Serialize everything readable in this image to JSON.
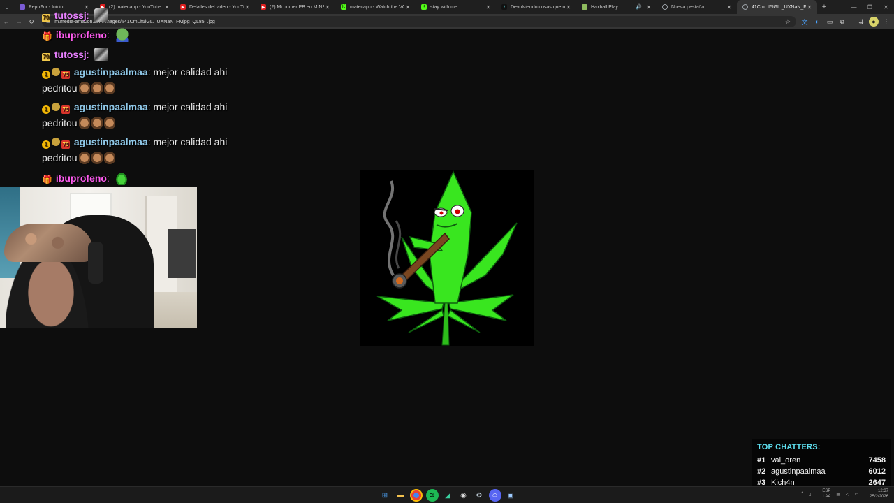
{
  "browser": {
    "tabs": [
      {
        "label": "PepuFor - Inicio",
        "favicon_color": "#7a5bd6"
      },
      {
        "label": "(2) matecapp - YouTube",
        "favicon_color": "#e02020"
      },
      {
        "label": "Detalles del video - YouTube",
        "favicon_color": "#e02020"
      },
      {
        "label": "(2) Mi primer PB en MINECRAFT",
        "favicon_color": "#e02020"
      },
      {
        "label": "matecapp - Watch the VOD of",
        "favicon_color": "#53fc18"
      },
      {
        "label": "stay with me",
        "favicon_color": "#53fc18"
      },
      {
        "label": "Devolviendo cosas que no",
        "favicon_color": "#111111"
      },
      {
        "label": "Haxball Play",
        "favicon_color": "#8fbc5f"
      },
      {
        "label": "Nueva pestaña",
        "favicon_color": "#9aa0a6"
      },
      {
        "label": "41CmLlf5lGL._UXNaN_FMjpg",
        "favicon_color": "#9aa0a6",
        "active": true
      }
    ],
    "url": "m.media-amazon.com/images/I/41CmLlf5lGL._UXNaN_FMjpg_QL85_.jpg",
    "icons": {
      "menu": "chevron-down-icon",
      "back": "back-arrow-icon",
      "forward": "forward-arrow-icon",
      "reload": "reload-icon",
      "star": "star-icon",
      "new_tab": "plus-icon"
    }
  },
  "chat": {
    "messages": [
      {
        "user": "tutossj",
        "text": ""
      },
      {
        "user": "ibuprofeno",
        "text": ""
      },
      {
        "user": "tutossj",
        "text": ""
      },
      {
        "user": "agustinpaalmaa",
        "text": "mejor calidad ahi",
        "line2": "pedritou"
      },
      {
        "user": "agustinpaalmaa",
        "text": "mejor calidad ahi",
        "line2": "pedritou"
      },
      {
        "user": "agustinpaalmaa",
        "text": "mejor calidad ahi",
        "line2": "pedritou"
      },
      {
        "user": "ibuprofeno",
        "text": ""
      }
    ],
    "badge_70": "70",
    "badge_one": "1"
  },
  "top_chatters": {
    "title": "TOP CHATTERS:",
    "entries": [
      {
        "rank": "#1",
        "name": "val_oren",
        "score": "7458"
      },
      {
        "rank": "#2",
        "name": "agustinpaalmaa",
        "score": "6012"
      },
      {
        "rank": "#3",
        "name": "Kich4n",
        "score": "2647"
      }
    ]
  },
  "taskbar": {
    "lang_top": "ESP",
    "lang_bottom": "LAA",
    "time": "12:37",
    "date": "25/2/2026"
  },
  "colors": {
    "accent_cyan": "#5ee0f0",
    "username_pink": "#ff5cf0",
    "username_blue": "#8fc8e8",
    "leaf_green": "#39e61f"
  }
}
